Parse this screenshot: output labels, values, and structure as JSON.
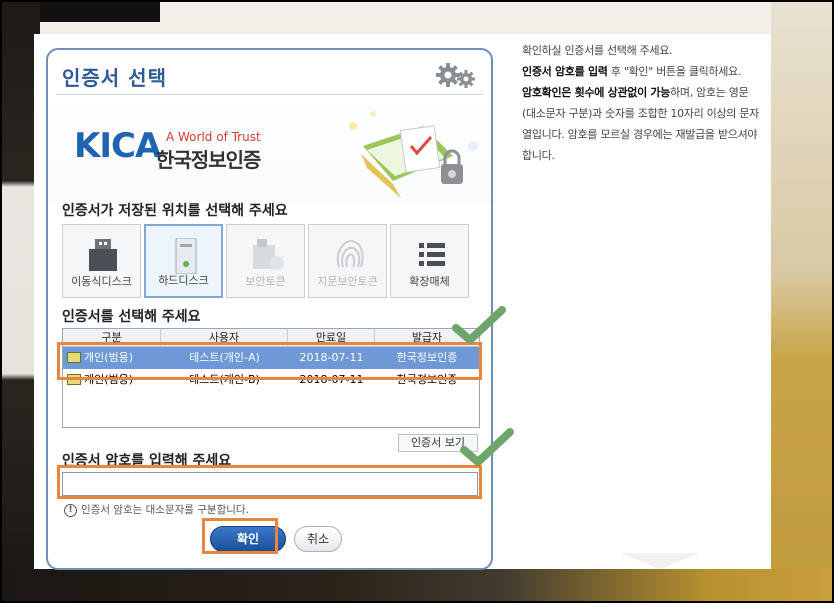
{
  "dialog": {
    "title": "인증서 선택",
    "logo": {
      "brand": "KICA",
      "tagline": "A World of Trust",
      "name_kr": "한국정보인증"
    }
  },
  "storage": {
    "label": "인증서가 저장된 위치를 선택해 주세요",
    "options": [
      {
        "label": "이동식디스크",
        "icon": "usb-drive-icon",
        "state": "normal"
      },
      {
        "label": "하드디스크",
        "icon": "hard-disk-icon",
        "state": "selected"
      },
      {
        "label": "보안토큰",
        "icon": "security-token-icon",
        "state": "disabled"
      },
      {
        "label": "지문보안토큰",
        "icon": "fingerprint-icon",
        "state": "disabled"
      },
      {
        "label": "확장매체",
        "icon": "list-icon",
        "state": "normal"
      }
    ]
  },
  "certs": {
    "label": "인증서를 선택해 주세요",
    "columns": [
      "구분",
      "사용자",
      "만료일",
      "발급자"
    ],
    "rows": [
      {
        "type": "개인(범용)",
        "user": "테스트(개인-A)",
        "expiry": "2018-07-11",
        "issuer": "한국정보인증",
        "selected": true
      },
      {
        "type": "개인(범용)",
        "user": "테스트(개인-B)",
        "expiry": "2018-07-11",
        "issuer": "한국정보인증",
        "selected": false
      }
    ],
    "view_button": "인증서 보기"
  },
  "password": {
    "label": "인증서 암호를 입력해 주세요",
    "value": "",
    "hint": "인증서 암호는 대소문자를 구분합니다."
  },
  "buttons": {
    "confirm": "확인",
    "cancel": "취소"
  },
  "instructions": {
    "line1": "확인하실 인증서를 선택해 주세요.",
    "line2_bold": "인증서 암호를 입력",
    "line2_rest": " 후 \"확인\" 버튼을 클릭하세요.",
    "line3_bold": "암호확인은 횟수에 상관없이 가능",
    "line3_rest": "하며, 암호는 영문(대소문자 구분)과 숫자를 조합한 10자리 이상의 문자열입니다. 암호를 모르실 경우에는 재발급을 받으셔야합니다."
  },
  "colors": {
    "highlight": "#e8873c",
    "check": "#6ea56a",
    "title": "#2e5a97",
    "selected_row": "#6e99d6"
  }
}
